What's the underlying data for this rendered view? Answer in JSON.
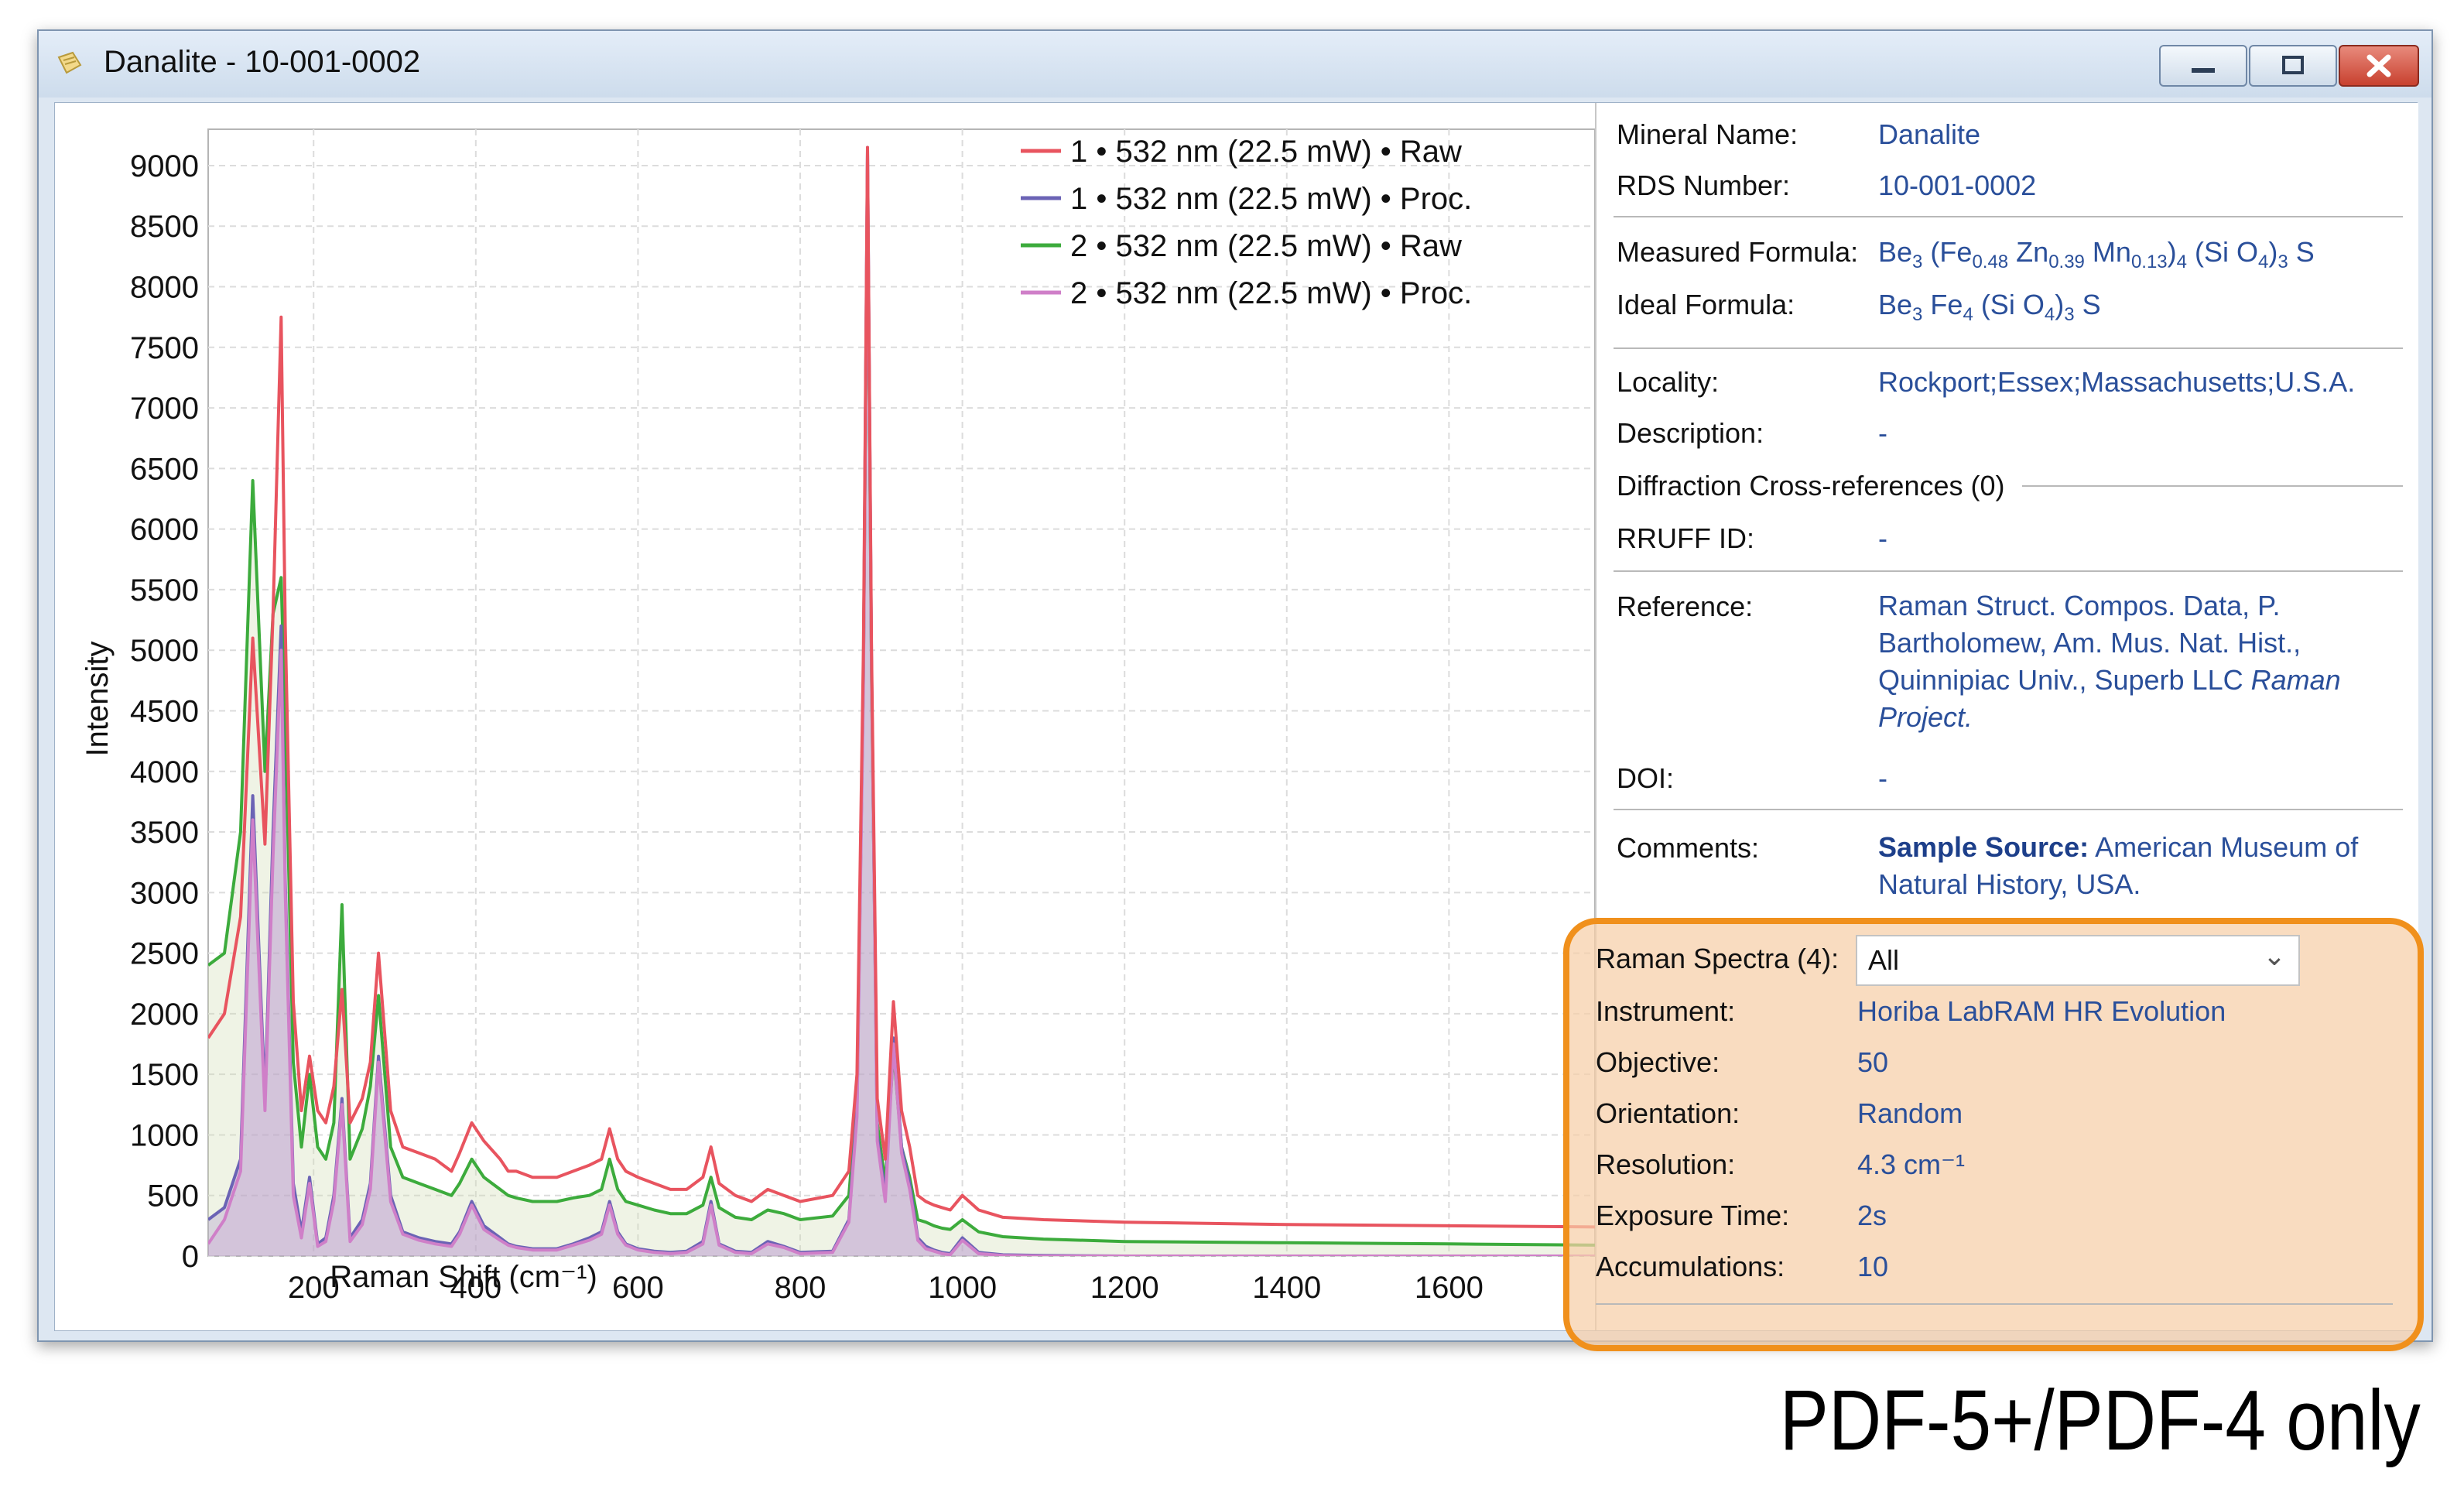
{
  "window": {
    "title": "Danalite - 10-001-0002",
    "buttons": {
      "minimize": "minimize",
      "maximize": "maximize",
      "close": "close"
    }
  },
  "chart_data": {
    "type": "line",
    "xlabel": "Raman Shift (cm⁻¹)",
    "ylabel": "Intensity",
    "xlim": [
      70,
      1780
    ],
    "ylim": [
      0,
      9300
    ],
    "x_ticks": [
      200,
      400,
      600,
      800,
      1000,
      1200,
      1400,
      1600
    ],
    "y_ticks": [
      0,
      500,
      1000,
      1500,
      2000,
      2500,
      3000,
      3500,
      4000,
      4500,
      5000,
      5500,
      6000,
      6500,
      7000,
      7500,
      8000,
      8500,
      9000
    ],
    "grid": true,
    "legend_position": "top-right",
    "series": [
      {
        "name": "1 • 532 nm (22.5 mW) • Raw",
        "color": "#e8545f",
        "x": [
          70,
          90,
          110,
          125,
          140,
          150,
          160,
          165,
          175,
          185,
          195,
          205,
          215,
          225,
          235,
          245,
          260,
          270,
          280,
          295,
          310,
          330,
          350,
          370,
          380,
          395,
          410,
          430,
          440,
          450,
          470,
          500,
          520,
          540,
          555,
          565,
          575,
          585,
          600,
          620,
          640,
          660,
          680,
          690,
          700,
          720,
          740,
          760,
          780,
          800,
          840,
          860,
          870,
          878,
          883,
          888,
          895,
          905,
          915,
          925,
          935,
          945,
          955,
          965,
          975,
          985,
          1000,
          1020,
          1050,
          1100,
          1200,
          1400,
          1600,
          1780
        ],
        "y": [
          1800,
          2000,
          2800,
          5100,
          3400,
          5300,
          7750,
          5200,
          2100,
          1200,
          1650,
          1200,
          1100,
          1400,
          2200,
          1100,
          1300,
          1600,
          2500,
          1200,
          900,
          850,
          800,
          700,
          850,
          1100,
          950,
          800,
          700,
          700,
          650,
          650,
          700,
          750,
          800,
          1050,
          800,
          700,
          650,
          600,
          550,
          550,
          650,
          900,
          600,
          500,
          450,
          550,
          500,
          450,
          500,
          700,
          1500,
          5000,
          9150,
          5000,
          1300,
          800,
          2100,
          1200,
          900,
          500,
          450,
          420,
          400,
          380,
          500,
          380,
          320,
          300,
          280,
          260,
          250,
          240
        ]
      },
      {
        "name": "1 • 532 nm (22.5 mW) • Proc.",
        "color": "#6b63b5",
        "x": [
          70,
          90,
          110,
          125,
          140,
          150,
          160,
          165,
          175,
          185,
          195,
          205,
          215,
          225,
          235,
          245,
          260,
          270,
          280,
          295,
          310,
          330,
          350,
          370,
          380,
          395,
          410,
          430,
          440,
          450,
          470,
          500,
          520,
          540,
          555,
          565,
          575,
          585,
          600,
          620,
          640,
          660,
          680,
          690,
          700,
          720,
          740,
          760,
          780,
          800,
          840,
          860,
          870,
          878,
          883,
          888,
          895,
          905,
          915,
          925,
          935,
          945,
          955,
          965,
          975,
          985,
          1000,
          1020,
          1050,
          1100,
          1200,
          1400,
          1600,
          1780
        ],
        "y": [
          300,
          400,
          800,
          3800,
          1300,
          3500,
          5200,
          3100,
          600,
          200,
          650,
          100,
          150,
          500,
          1300,
          150,
          300,
          600,
          1650,
          500,
          200,
          150,
          120,
          100,
          200,
          450,
          250,
          150,
          100,
          80,
          60,
          60,
          100,
          150,
          200,
          450,
          200,
          100,
          60,
          40,
          30,
          40,
          120,
          450,
          100,
          40,
          30,
          120,
          80,
          30,
          40,
          300,
          1200,
          4800,
          9150,
          4900,
          1000,
          500,
          1800,
          900,
          600,
          150,
          80,
          50,
          30,
          20,
          150,
          30,
          10,
          5,
          0,
          0,
          0,
          0
        ]
      },
      {
        "name": "2 • 532 nm (22.5 mW) • Raw",
        "color": "#3cab3c",
        "x": [
          70,
          90,
          110,
          125,
          140,
          150,
          160,
          165,
          175,
          185,
          195,
          205,
          215,
          225,
          235,
          245,
          260,
          270,
          280,
          295,
          310,
          330,
          350,
          370,
          380,
          395,
          410,
          430,
          440,
          450,
          470,
          500,
          520,
          540,
          555,
          565,
          575,
          585,
          600,
          620,
          640,
          660,
          680,
          690,
          700,
          720,
          740,
          760,
          780,
          800,
          840,
          860,
          870,
          878,
          883,
          888,
          895,
          905,
          915,
          925,
          935,
          945,
          955,
          965,
          975,
          985,
          1000,
          1020,
          1050,
          1100,
          1200,
          1400,
          1600,
          1780
        ],
        "y": [
          2400,
          2500,
          3500,
          6400,
          4000,
          5300,
          5600,
          4400,
          1600,
          900,
          1500,
          900,
          800,
          1100,
          2900,
          800,
          1050,
          1400,
          2150,
          900,
          650,
          600,
          550,
          500,
          600,
          800,
          650,
          550,
          500,
          480,
          450,
          450,
          480,
          500,
          550,
          800,
          550,
          450,
          420,
          380,
          350,
          350,
          420,
          650,
          400,
          320,
          300,
          380,
          350,
          300,
          330,
          500,
          1300,
          4800,
          9000,
          4800,
          1100,
          600,
          1700,
          900,
          650,
          300,
          280,
          250,
          230,
          220,
          300,
          200,
          160,
          140,
          120,
          110,
          100,
          90
        ]
      },
      {
        "name": "2 • 532 nm (22.5 mW) • Proc.",
        "color": "#cf7fc8",
        "x": [
          70,
          90,
          110,
          125,
          140,
          150,
          160,
          165,
          175,
          185,
          195,
          205,
          215,
          225,
          235,
          245,
          260,
          270,
          280,
          295,
          310,
          330,
          350,
          370,
          380,
          395,
          410,
          430,
          440,
          450,
          470,
          500,
          520,
          540,
          555,
          565,
          575,
          585,
          600,
          620,
          640,
          660,
          680,
          690,
          700,
          720,
          740,
          760,
          780,
          800,
          840,
          860,
          870,
          878,
          883,
          888,
          895,
          905,
          915,
          925,
          935,
          945,
          955,
          965,
          975,
          985,
          1000,
          1020,
          1050,
          1100,
          1200,
          1400,
          1600,
          1780
        ],
        "y": [
          100,
          300,
          700,
          3600,
          1200,
          3300,
          5000,
          3000,
          500,
          150,
          600,
          80,
          120,
          450,
          1250,
          120,
          260,
          550,
          1600,
          450,
          180,
          130,
          100,
          80,
          180,
          420,
          220,
          130,
          90,
          70,
          50,
          50,
          90,
          130,
          180,
          420,
          180,
          90,
          50,
          30,
          20,
          30,
          100,
          420,
          90,
          30,
          20,
          100,
          70,
          20,
          30,
          280,
          1150,
          4700,
          9100,
          4850,
          950,
          450,
          1750,
          850,
          550,
          130,
          60,
          40,
          20,
          10,
          130,
          20,
          5,
          0,
          0,
          0,
          0,
          0
        ]
      }
    ]
  },
  "info": {
    "mineral_name_label": "Mineral Name:",
    "mineral_name": "Danalite",
    "rds_label": "RDS Number:",
    "rds_number": "10-001-0002",
    "measured_formula_label": "Measured Formula:",
    "measured_formula": {
      "be": "Be",
      "be_sub": "3",
      "open": "(",
      "fe": "Fe",
      "fe_sub": "0.48",
      "zn": "Zn",
      "zn_sub": "0.39",
      "mn": "Mn",
      "mn_sub": "0.13",
      "close": ")",
      "group_sub": "4",
      "sio": "(Si O",
      "o_sub": "4",
      "close2": ")",
      "sio_sub": "3",
      "s": "S"
    },
    "ideal_formula_label": "Ideal Formula:",
    "ideal_formula": {
      "be": "Be",
      "be_sub": "3",
      "fe": "Fe",
      "fe_sub": "4",
      "sio": "(Si O",
      "o_sub": "4",
      "close": ")",
      "sio_sub": "3",
      "s": "S"
    },
    "locality_label": "Locality:",
    "locality": "Rockport;Essex;Massachusetts;U.S.A.",
    "description_label": "Description:",
    "description": "-",
    "diffraction_label": "Diffraction Cross-references (0)",
    "rruff_label": "RRUFF ID:",
    "rruff": "-",
    "reference_label": "Reference:",
    "reference_text": "Raman Struct. Compos. Data, P. Bartholomew, Am. Mus. Nat. Hist., Quinnipiac Univ., Superb LLC ",
    "reference_italic": "Raman Project.",
    "doi_label": "DOI:",
    "doi": "-",
    "comments_label": "Comments:",
    "comments_bold": "Sample Source:",
    "comments_text": " American Museum of Natural History, USA.",
    "raman_spectra_label": "Raman Spectra (4):",
    "raman_spectra_selected": "All",
    "instrument_label": "Instrument:",
    "instrument": "Horiba LabRAM HR Evolution",
    "objective_label": "Objective:",
    "objective": "50",
    "orientation_label": "Orientation:",
    "orientation": "Random",
    "resolution_label": "Resolution:",
    "resolution": "4.3 cm⁻¹",
    "exposure_label": "Exposure Time:",
    "exposure": "2s",
    "accumulations_label": "Accumulations:",
    "accumulations": "10"
  },
  "footnote": "PDF-5+/PDF-4 only",
  "colors": {
    "highlight_border": "#f0901c",
    "highlight_fill": "#f7cea8",
    "link": "#2a4f9a"
  }
}
